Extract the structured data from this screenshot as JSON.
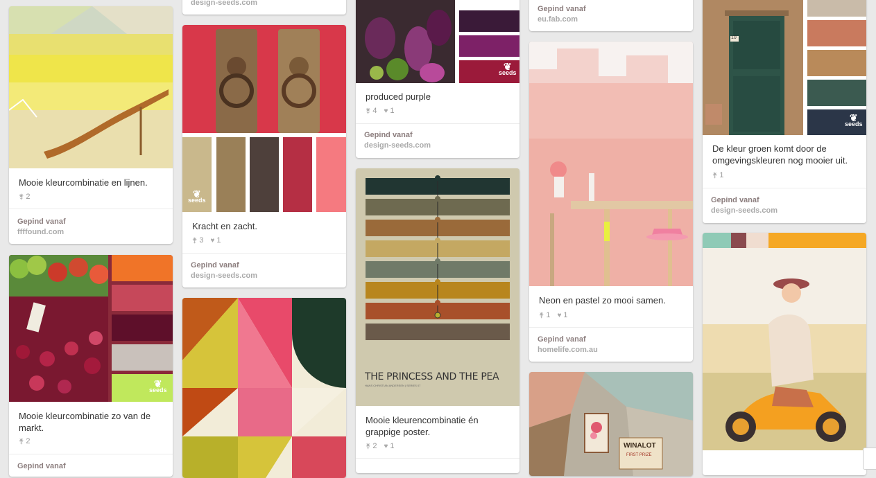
{
  "pins": [
    {
      "description": "Mooie kleurcombinatie en lijnen.",
      "repins": "2",
      "likes": "",
      "via_label": "Gepind vanaf",
      "source": "ffffound.com"
    },
    {
      "description": "Mooie kleurcombinatie zo van de markt.",
      "repins": "2",
      "likes": "",
      "via_label": "Gepind vanaf",
      "source": ""
    },
    {
      "description": "",
      "repins": "",
      "likes": "",
      "via_label": "",
      "source": "design-seeds.com"
    },
    {
      "description": "Kracht en zacht.",
      "repins": "3",
      "likes": "1",
      "via_label": "Gepind vanaf",
      "source": "design-seeds.com"
    },
    {
      "description": "",
      "repins": "",
      "likes": "",
      "via_label": "",
      "source": ""
    },
    {
      "description": "produced purple",
      "repins": "4",
      "likes": "1",
      "via_label": "Gepind vanaf",
      "source": "design-seeds.com"
    },
    {
      "description": "Mooie kleurencombinatie én grappige poster.",
      "repins": "2",
      "likes": "1",
      "via_label": "",
      "source": ""
    },
    {
      "description": "",
      "repins": "",
      "likes": "",
      "via_label": "Gepind vanaf",
      "source": "eu.fab.com"
    },
    {
      "description": "Neon en pastel zo mooi samen.",
      "repins": "1",
      "likes": "1",
      "via_label": "Gepind vanaf",
      "source": "homelife.com.au"
    },
    {
      "description": "",
      "repins": "",
      "likes": "",
      "via_label": "",
      "source": ""
    },
    {
      "description": "De kleur groen komt door de omgevingskleuren nog mooier uit.",
      "repins": "1",
      "likes": "",
      "via_label": "Gepind vanaf",
      "source": "design-seeds.com"
    },
    {
      "description": "",
      "repins": "",
      "likes": "",
      "via_label": "",
      "source": ""
    }
  ],
  "poster": {
    "title": "THE PRINCESS AND THE PEA",
    "subtitle": "HANS CHRISTIAN ANDERSEN | SERIES 07"
  },
  "sign": {
    "line1": "WINALOT",
    "line2": "FIRST PRIZE"
  },
  "seeds_logo_text": "seeds",
  "door_number": "10",
  "icons": {
    "repin": "repin-icon",
    "like": "heart-icon",
    "logo": "seeds-leaf-icon"
  },
  "colors": {
    "background": "#e9e9e9",
    "card": "#ffffff",
    "kracht_swatches": [
      "#c9b88c",
      "#9a8058",
      "#4e403b",
      "#b52f44",
      "#f57a80"
    ],
    "market_swatches": [
      "#f07428",
      "#c6485a",
      "#5e0f2a",
      "#c9c1bb",
      "#c0e85c"
    ],
    "purple_swatches": [
      "#3a1a38",
      "#7d2167",
      "#9b1a3a"
    ],
    "green_swatches": [
      "#c9bba9",
      "#c97a5e",
      "#b98a5a",
      "#3b5a50",
      "#2b3648"
    ],
    "vespa_strip": [
      "#8fcab6",
      "#8a4a4e",
      "#f0ddd0",
      "#f5a825"
    ]
  }
}
